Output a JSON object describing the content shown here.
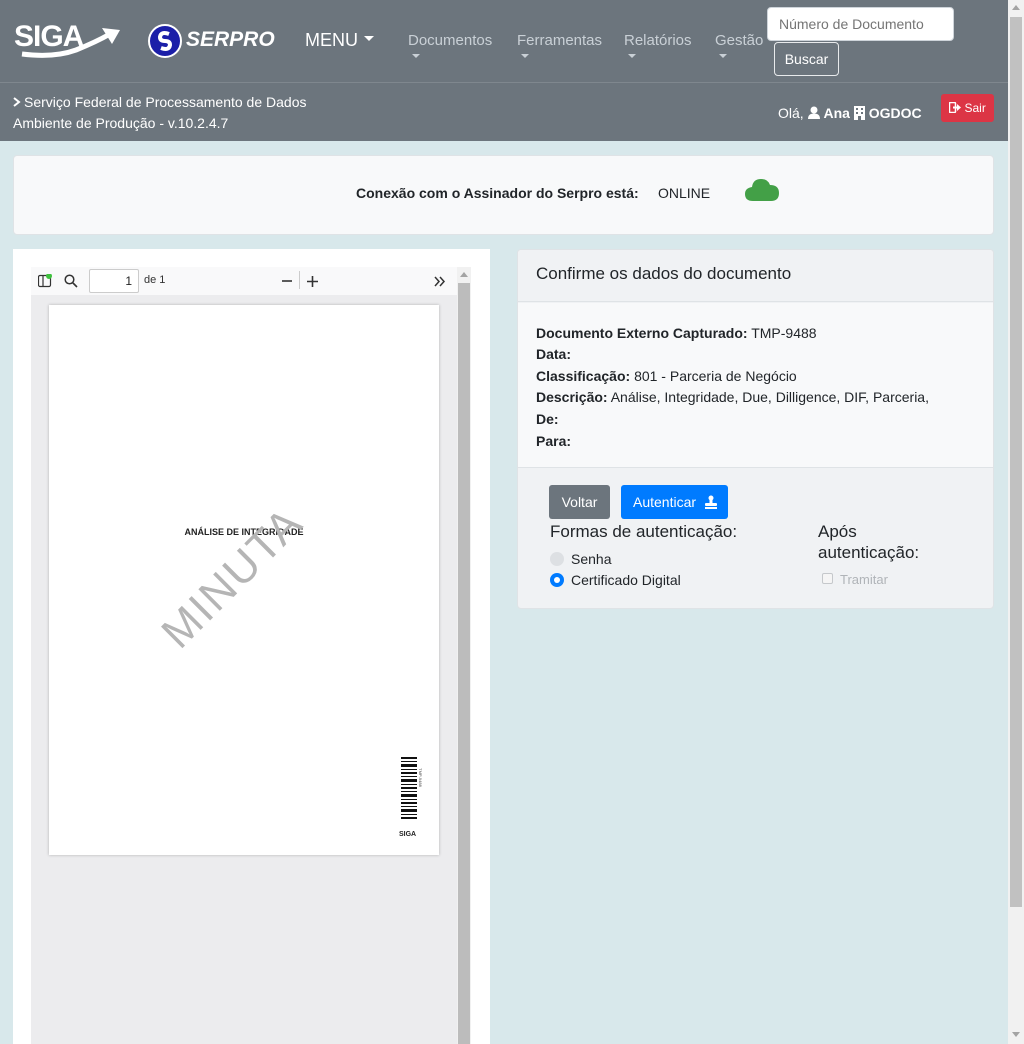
{
  "header": {
    "siga_logo": "SIGA",
    "serpro_logo": "SERPRO",
    "menu_label": "MENU",
    "nav": [
      "Documentos",
      "Ferramentas",
      "Relatórios",
      "Gestão"
    ],
    "search": {
      "placeholder": "Número de Documento",
      "button": "Buscar"
    }
  },
  "subbar": {
    "org": "Serviço Federal de Processamento de Dados",
    "env": "Ambiente de Produção - v.10.2.4.7",
    "greeting": "Olá,",
    "user": "Ana",
    "unit": "OGDOC",
    "logout": "Sair"
  },
  "connection": {
    "label": "Conexão com o Assinador do Serpro está:",
    "status": "ONLINE",
    "status_color": "#43a047"
  },
  "pdf_viewer": {
    "page_number": "1",
    "page_total_label": "de 1",
    "page": {
      "title": "ANÁLISE DE INTEGRIDADE",
      "watermark": "MINUTA",
      "barcode_text": "TMP-9488",
      "footer_logo": "SIGA"
    }
  },
  "confirm": {
    "title": "Confirme os dados do documento",
    "fields": [
      {
        "label": "Documento Externo Capturado:",
        "value": "TMP-9488"
      },
      {
        "label": "Data:",
        "value": ""
      },
      {
        "label": "Classificação:",
        "value": "801 - Parceria de Negócio"
      },
      {
        "label": "Descrição:",
        "value": "Análise, Integridade, Due, Dilligence, DIF, Parceria,"
      },
      {
        "label": "De:",
        "value": ""
      },
      {
        "label": "Para:",
        "value": ""
      }
    ],
    "back_button": "Voltar",
    "auth_button": "Autenticar",
    "auth_methods_title": "Formas de autenticação:",
    "auth_methods": [
      {
        "label": "Senha",
        "selected": false
      },
      {
        "label": "Certificado Digital",
        "selected": true
      }
    ],
    "after_title": "Após autenticação:",
    "after_option": {
      "label": "Tramitar",
      "checked": false,
      "enabled": false
    }
  },
  "colors": {
    "navbar": "#6c757d",
    "primary": "#007bff",
    "danger": "#dc3545",
    "background": "#d8e8eb"
  }
}
